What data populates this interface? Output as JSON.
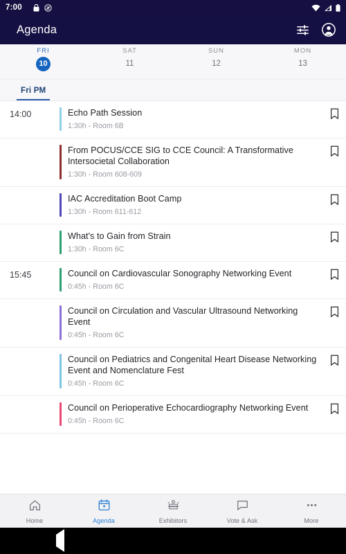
{
  "status_bar": {
    "time": "7:00",
    "icons": [
      "lock-icon",
      "dnd-icon",
      "wifi-icon",
      "signal-icon",
      "battery-icon"
    ]
  },
  "app_bar": {
    "title": "Agenda",
    "filter_icon": "tune-icon",
    "account_icon": "account-circle-icon"
  },
  "date_strip": {
    "days": [
      {
        "dow": "FRI",
        "num": "10",
        "selected": true
      },
      {
        "dow": "SAT",
        "num": "11",
        "selected": false
      },
      {
        "dow": "SUN",
        "num": "12",
        "selected": false
      },
      {
        "dow": "MON",
        "num": "13",
        "selected": false
      }
    ],
    "selected_color": "#1565c0"
  },
  "section_tabs": {
    "tabs": [
      {
        "label": "Fri PM",
        "active": true
      }
    ],
    "active_color": "#2a5ca8"
  },
  "agenda": {
    "slots": [
      {
        "time": "14:00",
        "sessions": [
          {
            "title": "Echo Path Session",
            "meta": "1:30h - Room 6B",
            "accent": "#8fcfe8",
            "bookmark_icon": "bookmark-outline-icon"
          },
          {
            "title": "From POCUS/CCE SIG to CCE Council: A Transformative Intersocietal Collaboration",
            "meta": "1:30h - Room 608-609",
            "accent": "#8e2c2c",
            "bookmark_icon": "bookmark-outline-icon"
          },
          {
            "title": "IAC Accreditation Boot Camp",
            "meta": "1:30h - Room 611-612",
            "accent": "#4f46b5",
            "bookmark_icon": "bookmark-outline-icon"
          },
          {
            "title": "What's to Gain from Strain",
            "meta": "1:30h - Room 6C",
            "accent": "#2f9e6e",
            "bookmark_icon": "bookmark-outline-icon"
          }
        ]
      },
      {
        "time": "15:45",
        "sessions": [
          {
            "title": "Council on Cardiovascular Sonography Networking Event",
            "meta": "0:45h - Room 6C",
            "accent": "#2f9e6e",
            "bookmark_icon": "bookmark-outline-icon"
          },
          {
            "title": "Council on Circulation and Vascular Ultrasound Networking Event",
            "meta": "0:45h - Room 6C",
            "accent": "#8b6fd4",
            "bookmark_icon": "bookmark-outline-icon"
          },
          {
            "title": "Council on Pediatrics and Congenital Heart Disease Networking Event and Nomenclature Fest",
            "meta": "0:45h - Room 6C",
            "accent": "#7fc4e4",
            "bookmark_icon": "bookmark-outline-icon"
          },
          {
            "title": "Council on Perioperative Echocardiography Networking Event",
            "meta": "0:45h - Room 6C",
            "accent": "#e8476f",
            "bookmark_icon": "bookmark-outline-icon"
          }
        ]
      }
    ]
  },
  "bottom_nav": {
    "items": [
      {
        "label": "Home",
        "icon": "home-icon",
        "active": false
      },
      {
        "label": "Agenda",
        "icon": "calendar-icon",
        "active": true
      },
      {
        "label": "Exhibitors",
        "icon": "exhibitors-icon",
        "active": false
      },
      {
        "label": "Vote & Ask",
        "icon": "chat-bubble-icon",
        "active": false
      },
      {
        "label": "More",
        "icon": "more-horizontal-icon",
        "active": false
      }
    ],
    "active_color": "#2a7fd4"
  },
  "system_nav": {
    "back": "back-triangle-icon",
    "home": "home-circle-icon",
    "recents": "recents-square-icon"
  }
}
